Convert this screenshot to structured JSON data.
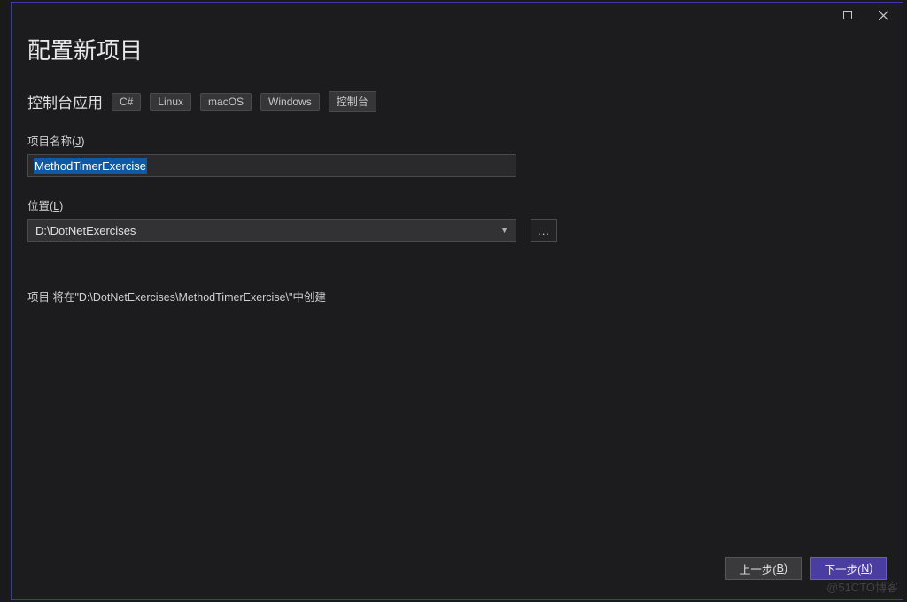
{
  "dialog": {
    "title": "配置新项目",
    "subtitle": "控制台应用",
    "tags": [
      "C#",
      "Linux",
      "macOS",
      "Windows",
      "控制台"
    ]
  },
  "fields": {
    "projectName": {
      "label": "项目名称(",
      "accel": "J",
      "labelEnd": ")",
      "value": "MethodTimerExercise"
    },
    "location": {
      "label": "位置(",
      "accel": "L",
      "labelEnd": ")",
      "value": "D:\\DotNetExercises",
      "browse": "..."
    }
  },
  "info": "项目 将在\"D:\\DotNetExercises\\MethodTimerExercise\\\"中创建",
  "buttons": {
    "back": "上一步(",
    "backAccel": "B",
    "backEnd": ")",
    "next": "下一步(",
    "nextAccel": "N",
    "nextEnd": ")"
  },
  "watermark": "@51CTO博客"
}
